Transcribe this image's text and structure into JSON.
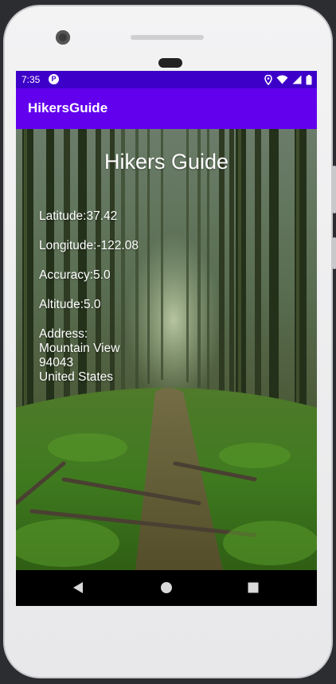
{
  "status_bar": {
    "time": "7:35",
    "icons": [
      "app-notification-icon",
      "location-icon",
      "wifi-icon",
      "cell-signal-icon",
      "battery-icon"
    ]
  },
  "app_bar": {
    "title": "HikersGuide"
  },
  "main": {
    "headline": "Hikers Guide",
    "latitude": "Latitude:37.42",
    "longitude": "Longitude:-122.08",
    "accuracy": "Accuracy:5.0",
    "altitude": "Altitude:5.0",
    "address_label": "Address:",
    "address_lines": [
      "Mountain View",
      "94043",
      "United States"
    ]
  },
  "nav_bar": {
    "buttons": [
      "back-icon",
      "home-icon",
      "recents-icon"
    ]
  },
  "colors": {
    "status_bar": "#3d00c8",
    "app_bar": "#6200ee",
    "nav_bar": "#000000",
    "text": "#ffffff"
  }
}
